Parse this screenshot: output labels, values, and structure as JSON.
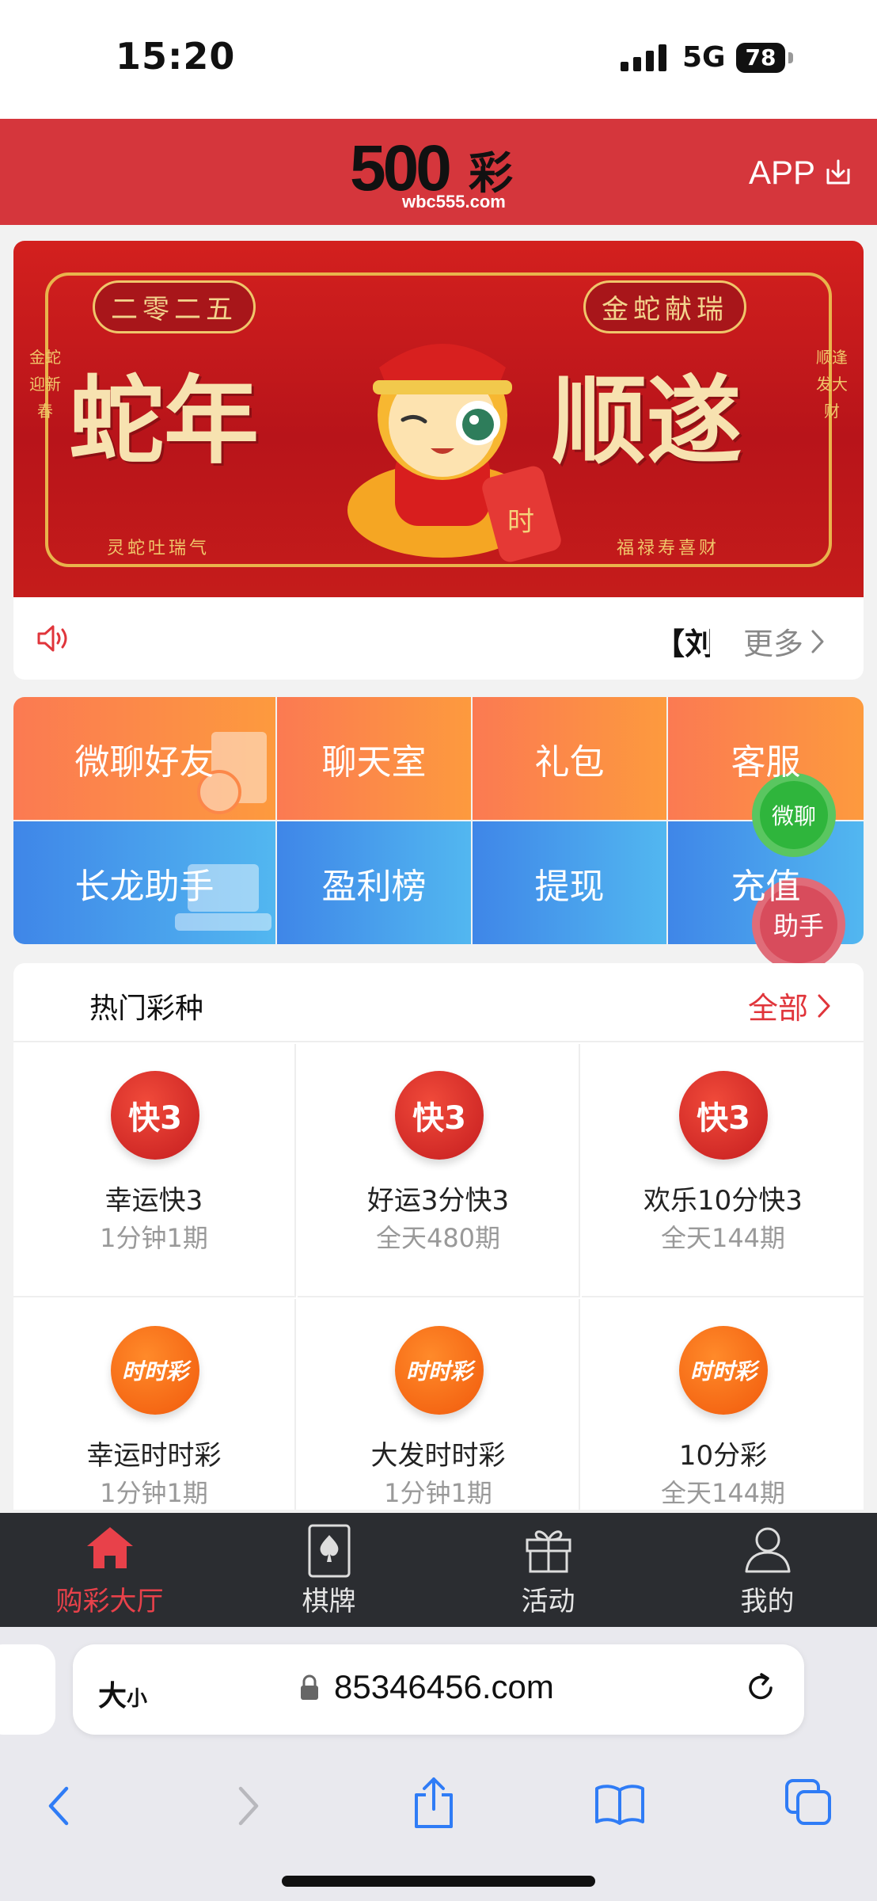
{
  "status_bar": {
    "time": "15:20",
    "network": "5G",
    "battery": "78"
  },
  "header": {
    "logo_number": "500",
    "logo_char": "彩",
    "logo_domain": "wbc555.com",
    "app_label": "APP"
  },
  "banner": {
    "tag_left": "二零二五",
    "tag_right": "金蛇献瑞",
    "side_left": "金蛇迎新春",
    "side_right": "顺逢发大财",
    "slogan_left": "蛇年",
    "slogan_right": "顺遂",
    "scroll_text": "时",
    "bottom_left": "灵蛇吐瑞气",
    "bottom_right": "福禄寿喜财"
  },
  "notice": {
    "text": "【刘",
    "more_label": "更多"
  },
  "features": {
    "row1": [
      "微聊好友",
      "聊天室",
      "礼包",
      "客服"
    ],
    "row2": [
      "长龙助手",
      "盈利榜",
      "提现",
      "充值"
    ]
  },
  "floating": {
    "wechat_label": "微聊",
    "helper_label": "助手"
  },
  "lottery_section": {
    "title": "热门彩种",
    "all_label": "全部",
    "items": [
      {
        "name": "幸运快3",
        "freq": "1分钟1期",
        "icon": "k3-dice-icon",
        "icon_text": "快3"
      },
      {
        "name": "好运3分快3",
        "freq": "全天480期",
        "icon": "k3-dice-icon",
        "icon_text": "快3"
      },
      {
        "name": "欢乐10分快3",
        "freq": "全天144期",
        "icon": "k3-dice-icon",
        "icon_text": "快3"
      },
      {
        "name": "幸运时时彩",
        "freq": "1分钟1期",
        "icon": "ssc-lottery-icon",
        "icon_text": "时时彩"
      },
      {
        "name": "大发时时彩",
        "freq": "1分钟1期",
        "icon": "ssc-lottery-icon",
        "icon_text": "时时彩"
      },
      {
        "name": "10分彩",
        "freq": "全天144期",
        "icon": "ssc-lottery-icon",
        "icon_text": "时时彩"
      }
    ]
  },
  "tab_bar": {
    "items": [
      {
        "label": "购彩大厅",
        "icon": "home-icon",
        "active": true
      },
      {
        "label": "棋牌",
        "icon": "spade-card-icon",
        "active": false
      },
      {
        "label": "活动",
        "icon": "gift-icon",
        "active": false
      },
      {
        "label": "我的",
        "icon": "user-icon",
        "active": false
      }
    ]
  },
  "browser": {
    "aa_label": "大",
    "aa_small": "小",
    "url": "85346456.com"
  },
  "colors": {
    "brand_red": "#d5363c",
    "accent_red": "#e0353b",
    "tab_bar": "#2b2d31",
    "wechat_green": "#2fb53c"
  }
}
